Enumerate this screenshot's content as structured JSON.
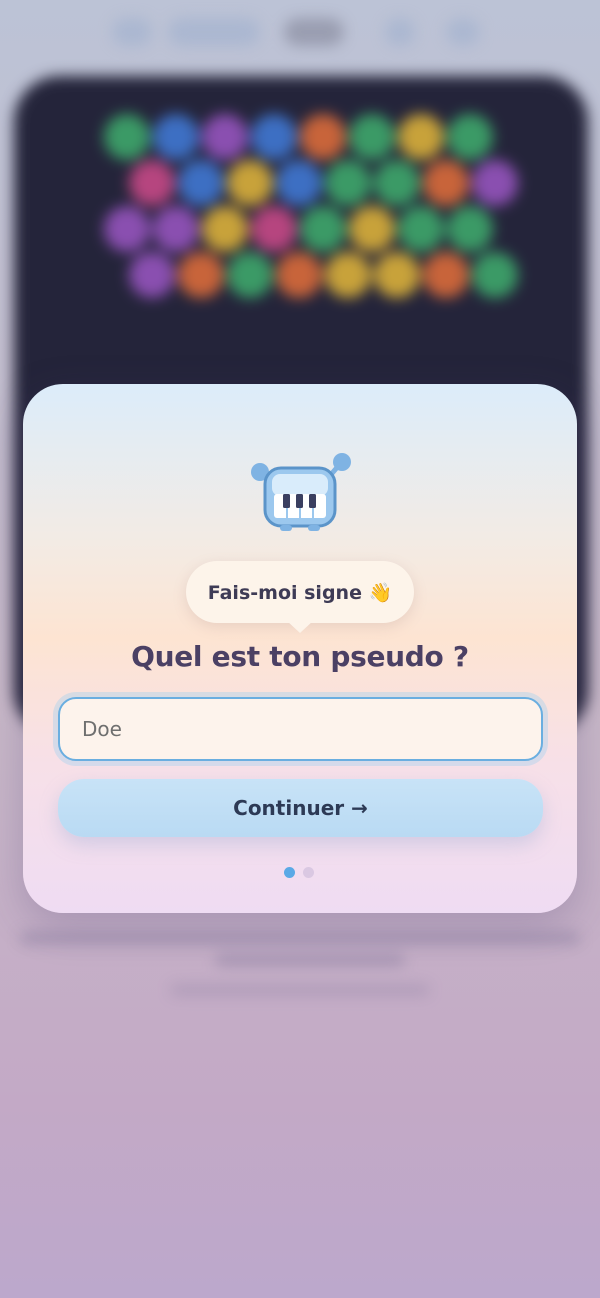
{
  "modal": {
    "speech_bubble": "Fais-moi signe 👋",
    "title": "Quel est ton pseudo ?",
    "username_input": {
      "placeholder": "Doe",
      "value": ""
    },
    "continue_button": "Continuer →",
    "pagination": {
      "total": 2,
      "current": 1
    },
    "mascot_icon": "piano-robot-icon"
  },
  "colors": {
    "accent_blue": "#5aa9e6",
    "button_bg": "#c8e3f7",
    "title_text": "#4b4064",
    "board_bg": "#24243a"
  },
  "background": {
    "bubble_colors": [
      "green",
      "blue",
      "purple",
      "orange",
      "yellow",
      "pink"
    ],
    "bubble_grid": [
      [
        "green",
        "blue",
        "purple",
        "blue",
        "orange",
        "green",
        "yellow",
        "green"
      ],
      [
        "pink",
        "blue",
        "yellow",
        "blue",
        "green",
        "green",
        "orange",
        "purple"
      ],
      [
        "purple",
        "purple",
        "yellow",
        "pink",
        "green",
        "yellow",
        "green",
        "green"
      ],
      [
        "purple",
        "orange",
        "green",
        "orange",
        "yellow",
        "yellow",
        "orange",
        "green"
      ]
    ]
  }
}
